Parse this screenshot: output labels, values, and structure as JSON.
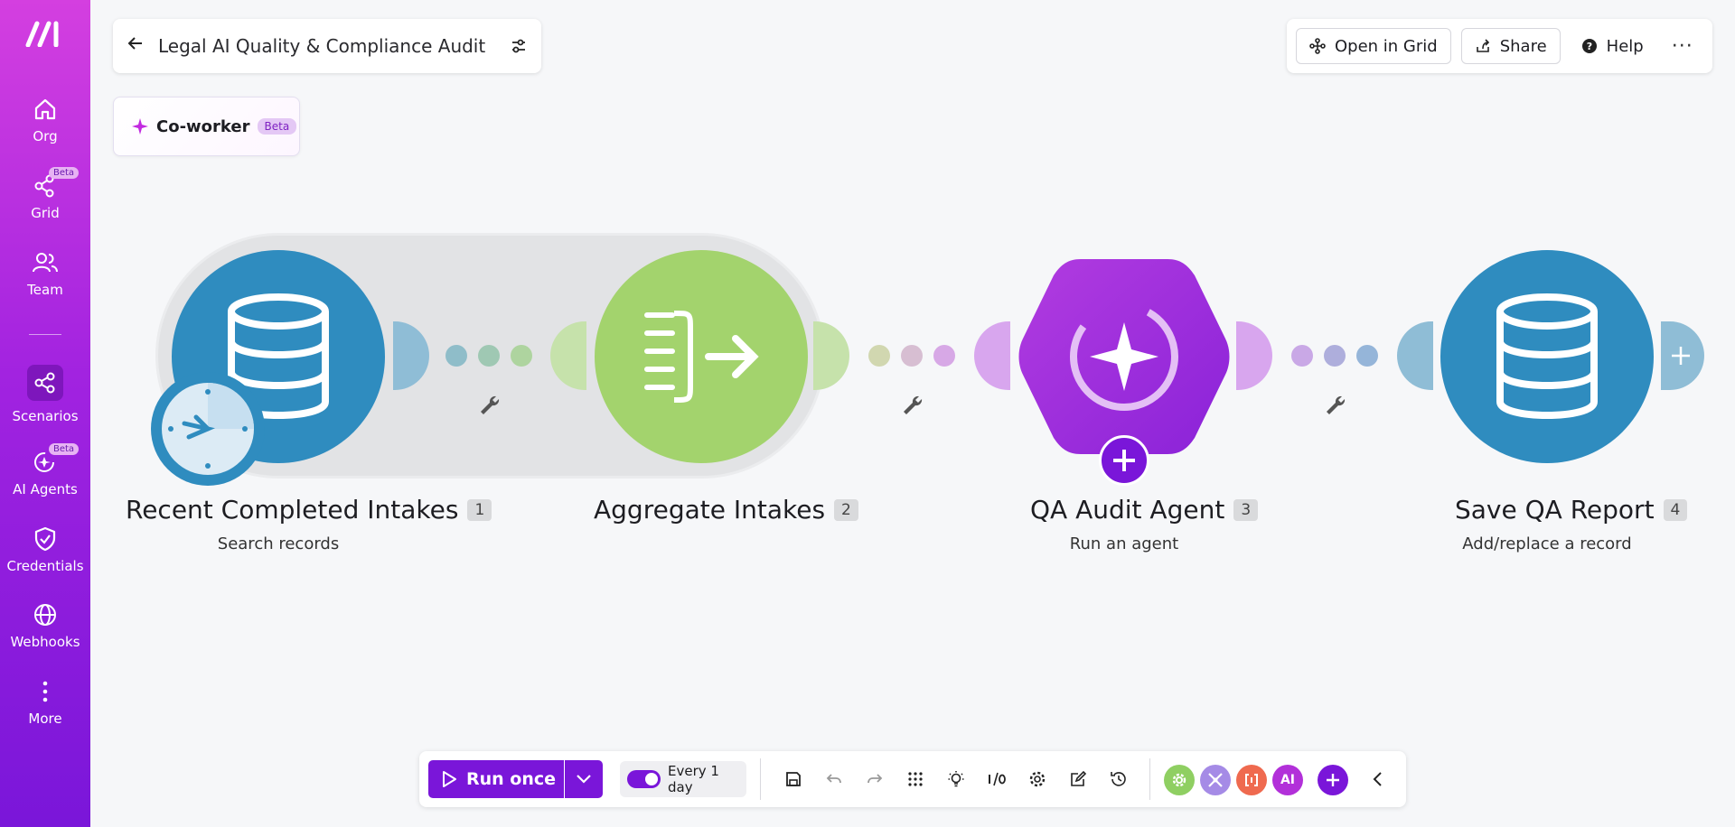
{
  "sidebar": {
    "items": [
      {
        "label": "Org"
      },
      {
        "label": "Grid",
        "badge": "Beta"
      },
      {
        "label": "Team"
      },
      {
        "label": "Scenarios"
      },
      {
        "label": "AI Agents",
        "badge": "Beta"
      },
      {
        "label": "Credentials"
      },
      {
        "label": "Webhooks"
      },
      {
        "label": "More"
      }
    ]
  },
  "header": {
    "title": "Legal AI Quality & Compliance Audit",
    "coworker_label": "Co-worker",
    "coworker_badge": "Beta"
  },
  "actions": {
    "open_in_grid": "Open in Grid",
    "share": "Share",
    "help": "Help"
  },
  "modules": [
    {
      "name": "Recent Completed Intakes",
      "num": "1",
      "sub": "Search records",
      "color": "#2f8cbf"
    },
    {
      "name": "Aggregate Intakes",
      "num": "2",
      "sub": "",
      "color": "#a3d36d"
    },
    {
      "name": "QA Audit Agent",
      "num": "3",
      "sub": "Run an agent",
      "color": "#9b2fe0"
    },
    {
      "name": "Save QA Report",
      "num": "4",
      "sub": "Add/replace a record",
      "color": "#2f8cbf"
    }
  ],
  "toolbar": {
    "run_label": "Run once",
    "schedule_label": "Every 1 day",
    "ai_chip": "AI"
  }
}
